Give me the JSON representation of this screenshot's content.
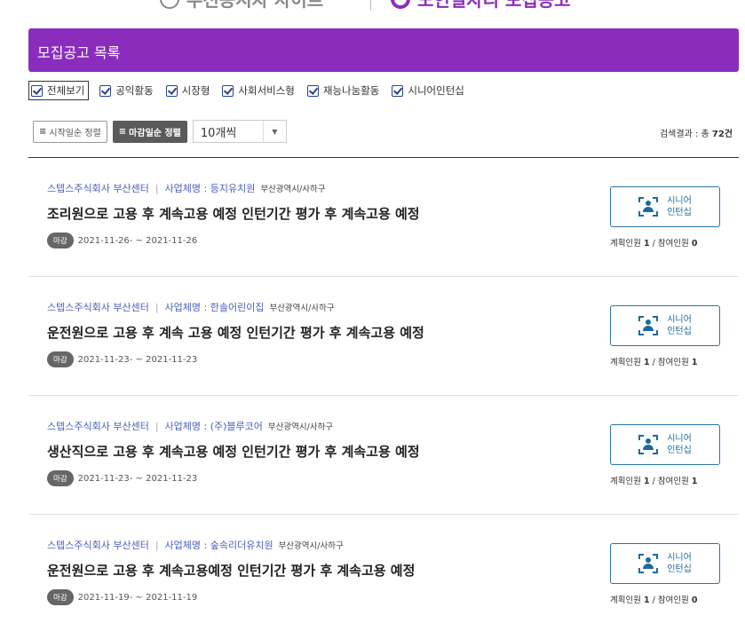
{
  "top_tabs": {
    "left_label": "우선공시자 사이트",
    "right_label": "노인일자리 모집공고"
  },
  "header": {
    "title": "모집공고 목록"
  },
  "filters": [
    {
      "label": "전체보기",
      "checked": true
    },
    {
      "label": "공익활동",
      "checked": true
    },
    {
      "label": "시장형",
      "checked": true
    },
    {
      "label": "사회서비스형",
      "checked": true
    },
    {
      "label": "재능나눔활동",
      "checked": true
    },
    {
      "label": "시니어인턴십",
      "checked": true
    }
  ],
  "controls": {
    "sort_start_label": "시작일순 정렬",
    "sort_end_label": "마감일순 정렬",
    "sort_icon": "≡",
    "page_size": "10개씩"
  },
  "result": {
    "prefix": "검색결과 : 총 ",
    "count": "72건"
  },
  "items": [
    {
      "org": "스텝스주식회사 부산센터",
      "employer": "사업체명 : 등지유치원",
      "region": "부산광역시/사하구",
      "title": "조리원으로 고용 후 계속고용 예정 인턴기간 평가 후 계속고용 예정",
      "badge": "마감",
      "dates": "2021-11-26- ~ 2021-11-26",
      "type_line1": "시니어",
      "type_line2": "인턴십",
      "planned_label": "계획인원 ",
      "planned": "1",
      "joined_label": " / 참여인원 ",
      "joined": "0"
    },
    {
      "org": "스텝스주식회사 부산센터",
      "employer": "사업체명 : 한솔어린이집",
      "region": "부산광역시/사하구",
      "title": "운전원으로 고용 후 계속 고용 예정 인턴기간 평가 후 계속고용 예정",
      "badge": "마감",
      "dates": "2021-11-23- ~ 2021-11-23",
      "type_line1": "시니어",
      "type_line2": "인턴십",
      "planned_label": "계획인원 ",
      "planned": "1",
      "joined_label": " / 참여인원 ",
      "joined": "1"
    },
    {
      "org": "스텝스주식회사 부산센터",
      "employer": "사업체명 : (주)블루코어",
      "region": "부산광역시/사하구",
      "title": "생산직으로 고용 후 계속고용 예정 인턴기간 평가 후 계속고용 예정",
      "badge": "마감",
      "dates": "2021-11-23- ~ 2021-11-23",
      "type_line1": "시니어",
      "type_line2": "인턴십",
      "planned_label": "계획인원 ",
      "planned": "1",
      "joined_label": " / 참여인원 ",
      "joined": "1"
    },
    {
      "org": "스텝스주식회사 부산센터",
      "employer": "사업체명 : 숲속리더유치원",
      "region": "부산광역시/사하구",
      "title": "운전원으로 고용 후 계속고용예정 인턴기간 평가 후 계속고용 예정",
      "badge": "마감",
      "dates": "2021-11-19- ~ 2021-11-19",
      "type_line1": "시니어",
      "type_line2": "인턴십",
      "planned_label": "계획인원 ",
      "planned": "1",
      "joined_label": " / 참여인원 ",
      "joined": "0"
    }
  ],
  "colors": {
    "header_bg": "#8a2dbc",
    "link_blue": "#4a5fc1",
    "type_button": "#1a6a9e"
  }
}
